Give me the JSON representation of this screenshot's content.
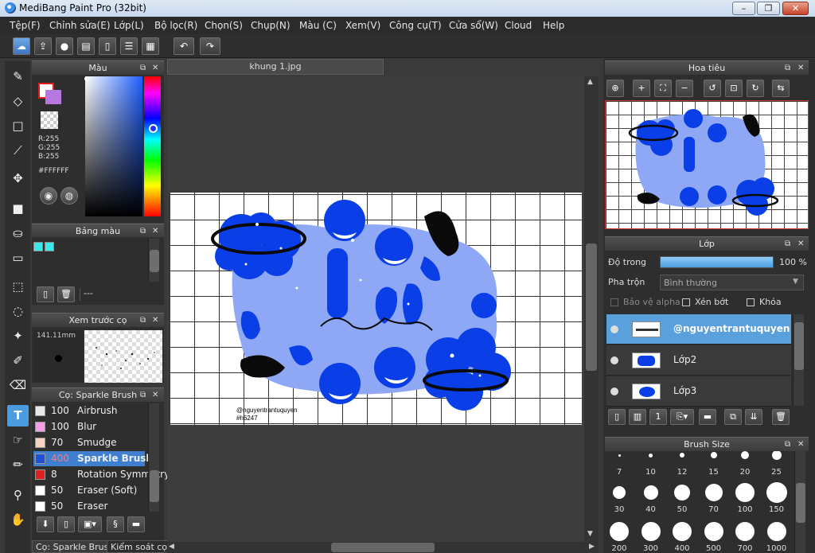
{
  "window": {
    "title": "MediBang Paint Pro (32bit)"
  },
  "menu": [
    "Tệp(F)",
    "Chỉnh sửa(E)",
    "Lớp(L)",
    "Bộ lọc(R)",
    "Chọn(S)",
    "Chụp(N)",
    "Màu (C)",
    "Xem(V)",
    "Công cụ(T)",
    "Cửa sổ(W)",
    "Cloud",
    "Help"
  ],
  "color_panel": {
    "title": "Màu",
    "r": "R:255",
    "g": "G:255",
    "b": "B:255",
    "hex": "#FFFFFF",
    "colors": {
      "foreground": "#ffffff",
      "foreground_border": "#e01c1c",
      "background": "#b478e0"
    }
  },
  "palette_panel": {
    "title": "Bảng màu",
    "swatch_color": "#3ee8e8",
    "selected_label": "---"
  },
  "brush_preview_panel": {
    "title": "Xem trước cọ",
    "size": "141.11mm"
  },
  "brush_list_panel": {
    "title": "Cọ: Sparkle Brush",
    "brushes": [
      {
        "size": "100",
        "name": "Airbrush",
        "color": "#e8e8e8"
      },
      {
        "size": "100",
        "name": "Blur",
        "color": "#f4a0e8"
      },
      {
        "size": "70",
        "name": "Smudge",
        "color": "#f8d4c0"
      },
      {
        "size": "400",
        "name": "Sparkle Brush",
        "color": "#2050d8"
      },
      {
        "size": "8",
        "name": "Rotation Symmetry",
        "color": "#e02020"
      },
      {
        "size": "50",
        "name": "Eraser (Soft)",
        "color": "#ffffff"
      },
      {
        "size": "50",
        "name": "Eraser",
        "color": "#ffffff"
      }
    ]
  },
  "bottom_tabs": [
    "Cọ: Sparkle Brush",
    "Kiểm soát cọ"
  ],
  "document": {
    "tab": "khung 1.jpg",
    "watermark_name": "@nguyentrantuquyen",
    "watermark_tag": "#h6247",
    "art_colors": {
      "blue": "#0a3fe8",
      "light_blue": "#8fa8f5",
      "black": "#0a0a0a"
    }
  },
  "navigator_panel": {
    "title": "Hoa tiêu"
  },
  "layers_panel": {
    "title": "Lớp",
    "opacity_label": "Độ trong",
    "opacity_value": "100 %",
    "opacity_fraction": 1.0,
    "blend_label": "Pha trộn",
    "blend_value": "Bình thường",
    "protect_alpha": "Bảo vệ alpha",
    "clipping": "Xén bớt",
    "lock": "Khóa",
    "layers": [
      {
        "name": "@nguyentrantuquyen",
        "selected": true
      },
      {
        "name": "Lớp2",
        "selected": false
      },
      {
        "name": "Lớp3",
        "selected": false
      }
    ]
  },
  "brush_size_panel": {
    "title": "Brush Size",
    "sizes": [
      "7",
      "10",
      "12",
      "15",
      "20",
      "25",
      "30",
      "40",
      "50",
      "70",
      "100",
      "150",
      "200",
      "300",
      "400",
      "500",
      "700",
      "1000"
    ]
  }
}
